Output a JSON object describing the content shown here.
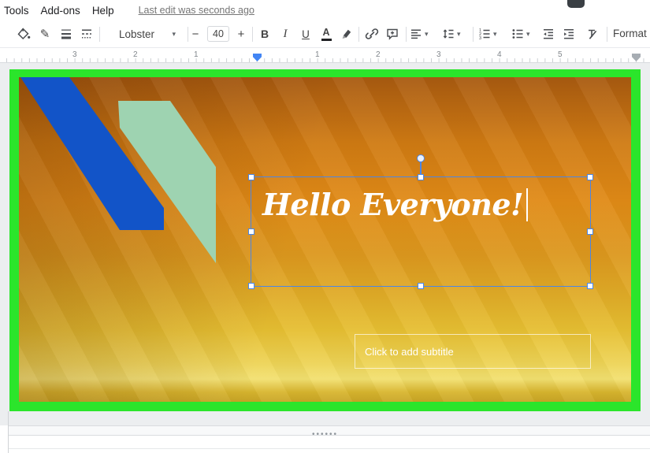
{
  "menu": {
    "items": [
      "Tools",
      "Add-ons",
      "Help"
    ],
    "last_edit": "Last edit was seconds ago"
  },
  "toolbar": {
    "font_name": "Lobster",
    "font_size": "40",
    "minus": "−",
    "plus": "+",
    "bold": "B",
    "italic": "I",
    "underline": "U",
    "text_color": "A",
    "caret": "▾",
    "pencil_glyph": "✎",
    "format_options": "Format op"
  },
  "ruler": {
    "numbers": [
      "3",
      "2",
      "1",
      "1",
      "2",
      "3",
      "4",
      "5"
    ]
  },
  "slide": {
    "title": "Hello Everyone!",
    "subtitle_placeholder": "Click to add subtitle"
  },
  "splitter": {
    "dots": "••••••"
  },
  "colors": {
    "frame_green": "#2be52b",
    "shape_blue": "#1254c8",
    "shape_teal": "#9ed3b1",
    "selection_blue": "#4a86e8",
    "gradient_top": "#a85a10",
    "gradient_bottom": "#c9a626"
  }
}
